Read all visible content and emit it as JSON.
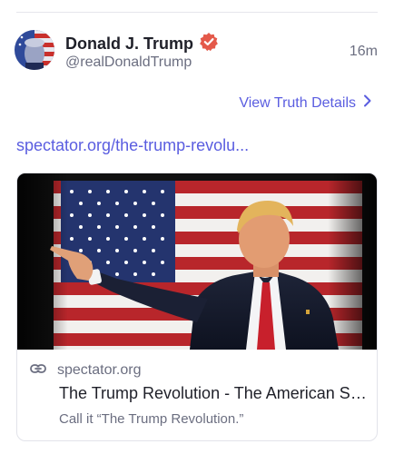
{
  "post": {
    "author": {
      "display_name": "Donald J. Trump",
      "handle": "@realDonaldTrump",
      "verified": true
    },
    "timestamp": "16m",
    "details_link": "View Truth Details",
    "url_text": "spectator.org/the-trump-revolu..."
  },
  "card": {
    "domain": "spectator.org",
    "title": "The Trump Revolution - The American Spectator | USA News and Politics",
    "description": "Call it “The Trump Revolution.”"
  },
  "icons": {
    "verified": "verified-badge-icon",
    "chevron": "chevron-right-icon",
    "link": "link-icon"
  },
  "colors": {
    "link_accent": "#5a5de0",
    "verified_badge": "#e4594a",
    "muted_text": "#6b6e80",
    "primary_text": "#1f2029"
  }
}
